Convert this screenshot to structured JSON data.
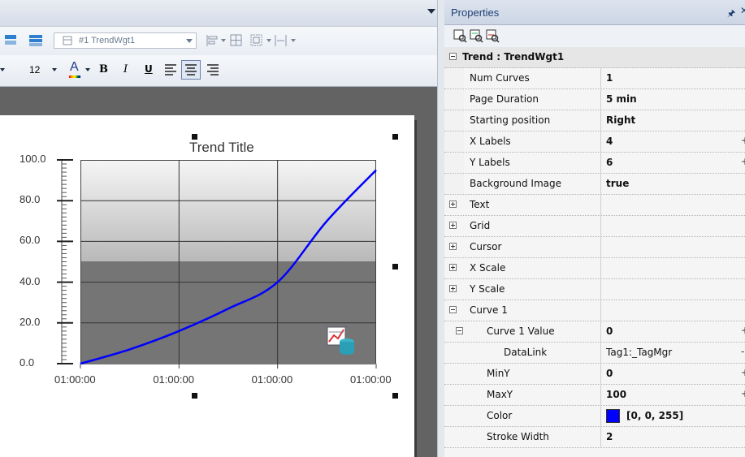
{
  "toolbar": {
    "widget_selector": "#1 TrendWgt1",
    "font_size": "12"
  },
  "chart": {
    "title": "Trend Title",
    "y_ticks": [
      "100.0",
      "80.0",
      "60.0",
      "40.0",
      "20.0",
      "0.0"
    ],
    "x_ticks": [
      "01:00:00",
      "01:00:00",
      "01:00:00",
      "01:00:00"
    ],
    "curve_color": "#0000ff"
  },
  "chart_data": {
    "type": "line",
    "title": "Trend Title",
    "x": [
      "01:00:00",
      "",
      "01:00:00",
      "",
      "01:00:00",
      "",
      "01:00:00"
    ],
    "series": [
      {
        "values": [
          0,
          7,
          16,
          27,
          40,
          70,
          95
        ]
      }
    ],
    "ylim": [
      0,
      100
    ],
    "grid": true
  },
  "properties": {
    "panel_title": "Properties",
    "object_header": "Trend : TrendWgt1",
    "rows": [
      {
        "name": "Num Curves",
        "value": "1"
      },
      {
        "name": "Page Duration",
        "value": "5 min"
      },
      {
        "name": "Starting position",
        "value": "Right"
      },
      {
        "name": "X Labels",
        "value": "4"
      },
      {
        "name": "Y Labels",
        "value": "6"
      },
      {
        "name": "Background Image",
        "value": "true"
      }
    ],
    "groups": [
      "Text",
      "Grid",
      "Cursor",
      "X Scale",
      "Y Scale"
    ],
    "curve1": {
      "label": "Curve 1",
      "value_name": "Curve 1 Value",
      "value": "0",
      "datalink_name": "DataLink",
      "datalink_value": "Tag1:_TagMgr",
      "miny_name": "MinY",
      "miny_value": "0",
      "maxy_name": "MaxY",
      "maxy_value": "100",
      "color_name": "Color",
      "color_value": "[0, 0, 255]",
      "color_hex": "#0000ff",
      "stroke_name": "Stroke Width",
      "stroke_value": "2"
    }
  }
}
